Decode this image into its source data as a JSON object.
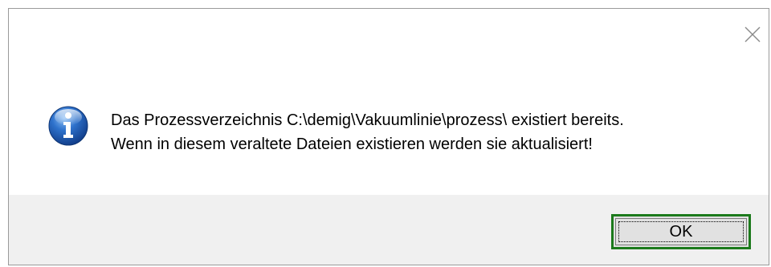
{
  "dialog": {
    "message_line1": "Das Prozessverzeichnis C:\\demig\\Vakuumlinie\\prozess\\ existiert bereits.",
    "message_line2": "Wenn in diesem veraltete Dateien existieren werden sie aktualisiert!",
    "icon": "info-icon",
    "close_icon": "close-icon"
  },
  "buttons": {
    "ok_label": "OK"
  },
  "colors": {
    "footer_bg": "#f0f0f0",
    "ok_highlight_border": "#1c7a1c",
    "icon_blue": "#1f5fb8"
  }
}
